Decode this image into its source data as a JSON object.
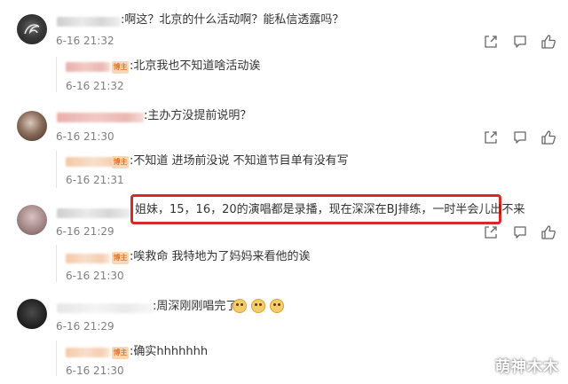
{
  "comments": [
    {
      "text": ":啊这？北京的什么活动啊？能私信透露吗？",
      "time": "6-16 21:32",
      "reply": {
        "badge": "博主",
        "text": ":北京我也不知道啥活动诶",
        "time": "6-16 21:32"
      }
    },
    {
      "text": ":主办方没提前说明？",
      "time": "6-16 21:30",
      "reply": {
        "badge": "博主",
        "text": ":不知道 进场前没说 不知道节目单有没有写",
        "time": "6-16 21:31"
      }
    },
    {
      "text": "姐妹，15，16，20的演唱都是录播，现在深深在BJ排练，一时半会儿出不来",
      "time": "6-16 21:29",
      "reply": {
        "badge": "博主",
        "text": ":唉救命 我特地为了妈妈来看他的诶",
        "time": "6-16 21:30"
      }
    },
    {
      "text": ":周深刚刚唱完了",
      "time": "6-16 21:29",
      "reply": {
        "badge": "博主",
        "text": ":确实hhhhhhh",
        "time": "6-16 21:30"
      }
    }
  ],
  "icons": [
    "share-icon",
    "comment-icon",
    "like-icon"
  ],
  "watermark": "萌神木木",
  "colors": {
    "highlight": "#d42a2a",
    "badge_bg": "#f7d9b8",
    "badge_text": "#e5762c",
    "time": "#808080"
  }
}
